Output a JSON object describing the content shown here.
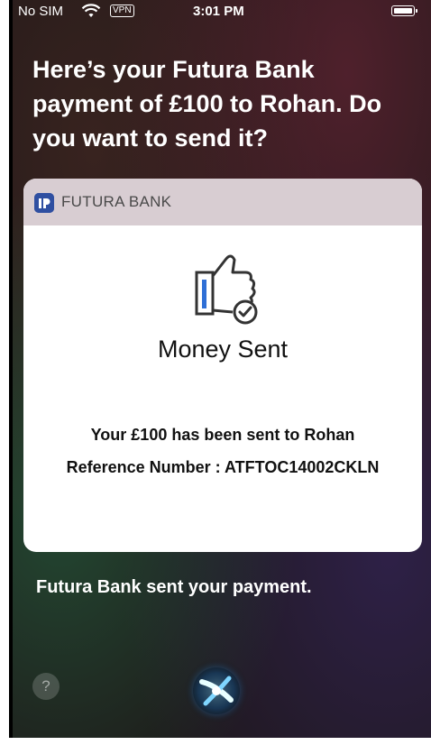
{
  "status_bar": {
    "carrier": "No SIM",
    "vpn": "VPN",
    "time": "3:01 PM",
    "wifi_icon": "wifi-icon",
    "battery_icon": "battery-icon"
  },
  "siri": {
    "prompt": "Here’s your Futura Bank payment of £100 to Rohan. Do you want to send it?",
    "response": "Futura Bank sent your payment.",
    "help_label": "?"
  },
  "card": {
    "brand": "FUTURA BANK",
    "icon": "thumbs-up-check-icon",
    "title": "Money Sent",
    "message": "Your £100 has been sent to Rohan",
    "reference": "Reference Number : ATFTOC14002CKLN"
  },
  "colors": {
    "brand_blue": "#2f4fa1",
    "card_header": "#d8cdd2"
  }
}
